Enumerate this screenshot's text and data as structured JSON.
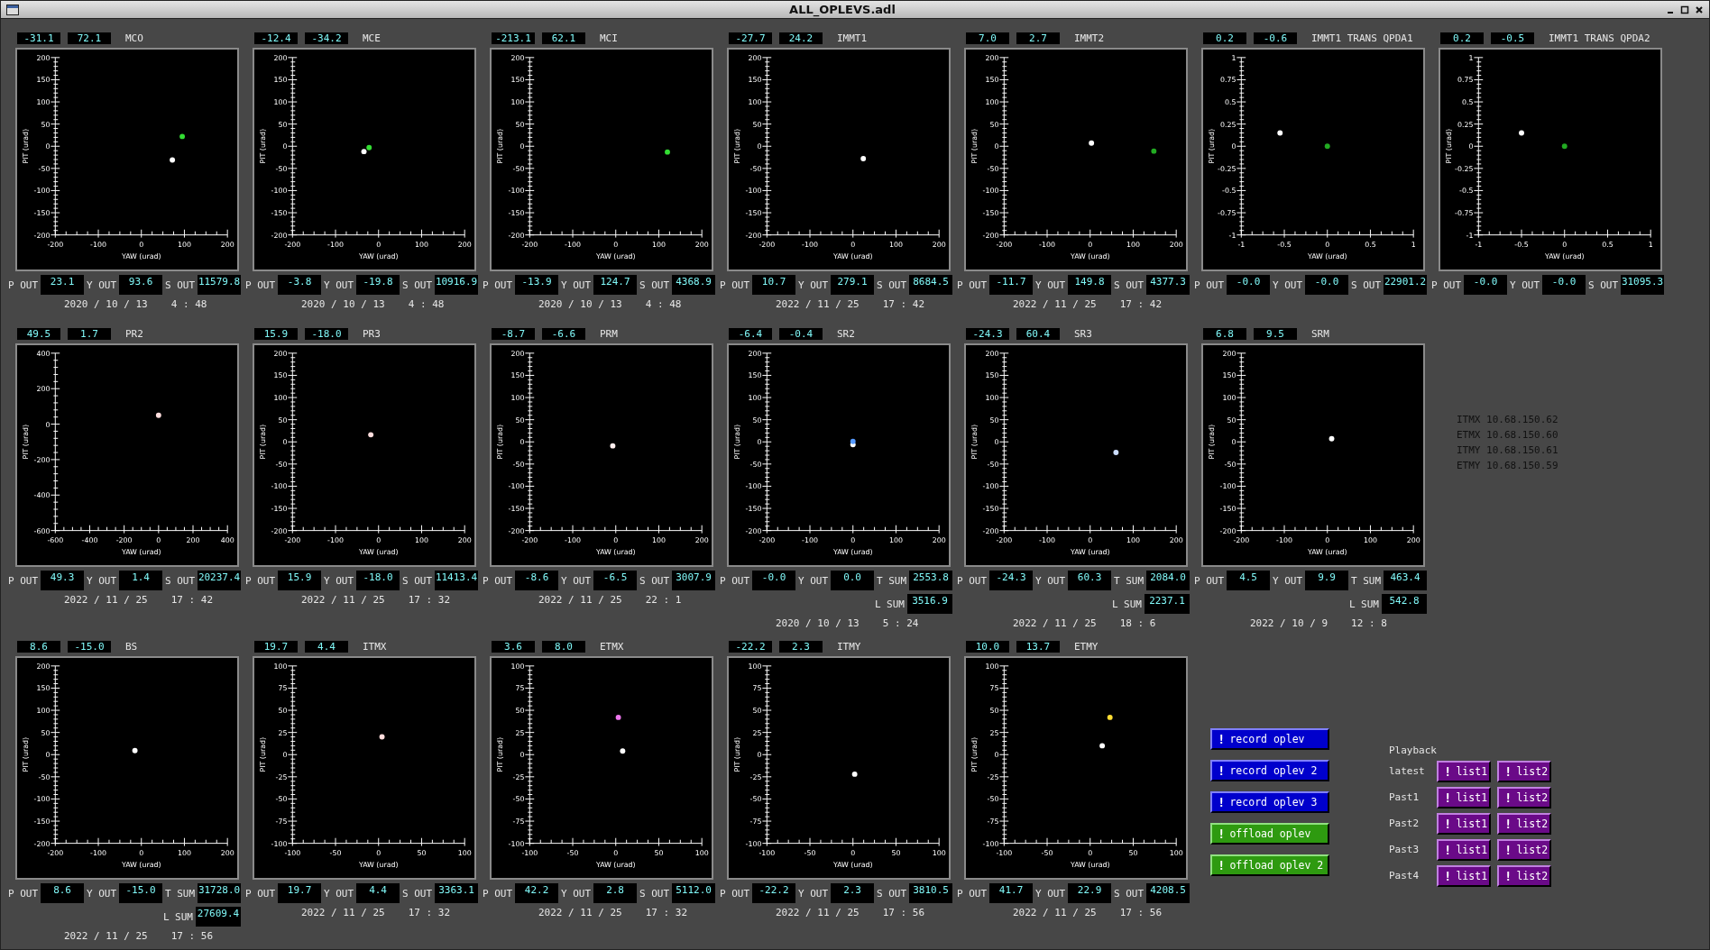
{
  "title_bar": {
    "title": "ALL_OPLEVS.adl"
  },
  "rows": [
    {
      "panels": [
        {
          "name": "MCO",
          "heading": [
            "-31.1",
            "72.1"
          ],
          "readouts": [
            {
              "label": "P OUT",
              "value": "23.1"
            },
            {
              "label": "Y OUT",
              "value": "93.6"
            },
            {
              "label": "S OUT",
              "value": "11579.8"
            }
          ],
          "date": "2020 / 10 / 13",
          "time": "4 : 48",
          "chart_data": {
            "type": "scatter",
            "xlabel": "YAW (urad)",
            "ylabel": "PIT (urad)",
            "xlim": [
              -200,
              200
            ],
            "ylim": [
              -200,
              200
            ],
            "xticks": [
              -200,
              -100,
              0,
              100,
              200
            ],
            "yticks": [
              -200,
              -150,
              -100,
              -50,
              0,
              50,
              100,
              150,
              200
            ],
            "series": [
              {
                "color": "#ffffff",
                "x": [
                  72
                ],
                "values": [
                  -31
                ]
              },
              {
                "color": "#33dd33",
                "x": [
                  95
                ],
                "values": [
                  22
                ]
              }
            ]
          }
        },
        {
          "name": "MCE",
          "heading": [
            "-12.4",
            "-34.2"
          ],
          "readouts": [
            {
              "label": "P OUT",
              "value": "-3.8"
            },
            {
              "label": "Y OUT",
              "value": "-19.8"
            },
            {
              "label": "S OUT",
              "value": "10916.9"
            }
          ],
          "date": "2020 / 10 / 13",
          "time": "4 : 48",
          "chart_data": {
            "type": "scatter",
            "xlabel": "YAW (urad)",
            "ylabel": "PIT (urad)",
            "xlim": [
              -200,
              200
            ],
            "ylim": [
              -200,
              200
            ],
            "xticks": [
              -200,
              -100,
              0,
              100,
              200
            ],
            "yticks": [
              -200,
              -150,
              -100,
              -50,
              0,
              50,
              100,
              150,
              200
            ],
            "series": [
              {
                "color": "#ffffff",
                "x": [
                  -34
                ],
                "values": [
                  -12
                ]
              },
              {
                "color": "#33dd33",
                "x": [
                  -22
                ],
                "values": [
                  -3
                ]
              }
            ]
          }
        },
        {
          "name": "MCI",
          "heading": [
            "-213.1",
            "62.1"
          ],
          "readouts": [
            {
              "label": "P OUT",
              "value": "-13.9"
            },
            {
              "label": "Y OUT",
              "value": "124.7"
            },
            {
              "label": "S OUT",
              "value": "4368.9"
            }
          ],
          "date": "2020 / 10 / 13",
          "time": "4 : 48",
          "chart_data": {
            "type": "scatter",
            "xlabel": "YAW (urad)",
            "ylabel": "PIT (urad)",
            "xlim": [
              -200,
              200
            ],
            "ylim": [
              -200,
              200
            ],
            "xticks": [
              -200,
              -100,
              0,
              100,
              200
            ],
            "yticks": [
              -200,
              -150,
              -100,
              -50,
              0,
              50,
              100,
              150,
              200
            ],
            "series": [
              {
                "color": "#33dd33",
                "x": [
                  120
                ],
                "values": [
                  -13
                ]
              }
            ]
          }
        },
        {
          "name": "IMMT1",
          "heading": [
            "-27.7",
            "24.2"
          ],
          "readouts": [
            {
              "label": "P OUT",
              "value": "10.7"
            },
            {
              "label": "Y OUT",
              "value": "279.1"
            },
            {
              "label": "S OUT",
              "value": "8684.5"
            }
          ],
          "date": "2022 / 11 / 25",
          "time": "17 : 42",
          "chart_data": {
            "type": "scatter",
            "xlabel": "YAW (urad)",
            "ylabel": "PIT (urad)",
            "xlim": [
              -200,
              200
            ],
            "ylim": [
              -200,
              200
            ],
            "xticks": [
              -200,
              -100,
              0,
              100,
              200
            ],
            "yticks": [
              -200,
              -150,
              -100,
              -50,
              0,
              50,
              100,
              150,
              200
            ],
            "series": [
              {
                "color": "#ffffff",
                "x": [
                  24
                ],
                "values": [
                  -28
                ]
              }
            ]
          }
        },
        {
          "name": "IMMT2",
          "heading": [
            "7.0",
            "2.7"
          ],
          "readouts": [
            {
              "label": "P OUT",
              "value": "-11.7"
            },
            {
              "label": "Y OUT",
              "value": "149.8"
            },
            {
              "label": "S OUT",
              "value": "4377.3"
            }
          ],
          "date": "2022 / 11 / 25",
          "time": "17 : 42",
          "chart_data": {
            "type": "scatter",
            "xlabel": "YAW (urad)",
            "ylabel": "PIT (urad)",
            "xlim": [
              -200,
              200
            ],
            "ylim": [
              -200,
              200
            ],
            "xticks": [
              -200,
              -100,
              0,
              100,
              200
            ],
            "yticks": [
              -200,
              -150,
              -100,
              -50,
              0,
              50,
              100,
              150,
              200
            ],
            "series": [
              {
                "color": "#ffffff",
                "x": [
                  3
                ],
                "values": [
                  7
                ]
              },
              {
                "color": "#22aa22",
                "x": [
                  148
                ],
                "values": [
                  -11
                ]
              }
            ]
          }
        },
        {
          "name": "IMMT1 TRANS QPDA1",
          "heading": [
            "0.2",
            "-0.6"
          ],
          "readouts": [
            {
              "label": "P OUT",
              "value": "-0.0"
            },
            {
              "label": "Y OUT",
              "value": "-0.0"
            },
            {
              "label": "S OUT",
              "value": "22901.2"
            }
          ],
          "chart_data": {
            "type": "scatter",
            "xlabel": "YAW (urad)",
            "ylabel": "PIT (urad)",
            "xlim": [
              -1,
              1
            ],
            "ylim": [
              -1,
              1
            ],
            "xticks": [
              -1,
              -0.5,
              0,
              0.5,
              1
            ],
            "yticks": [
              -1,
              -0.75,
              -0.5,
              -0.25,
              0,
              0.25,
              0.5,
              0.75,
              1
            ],
            "series": [
              {
                "color": "#ffffff",
                "x": [
                  -0.55
                ],
                "values": [
                  0.15
                ]
              },
              {
                "color": "#22aa22",
                "x": [
                  0
                ],
                "values": [
                  0
                ]
              }
            ]
          }
        },
        {
          "name": "IMMT1 TRANS QPDA2",
          "heading": [
            "0.2",
            "-0.5"
          ],
          "readouts": [
            {
              "label": "P OUT",
              "value": "-0.0"
            },
            {
              "label": "Y OUT",
              "value": "-0.0"
            },
            {
              "label": "S OUT",
              "value": "31095.3"
            }
          ],
          "chart_data": {
            "type": "scatter",
            "xlabel": "YAW (urad)",
            "ylabel": "PIT (urad)",
            "xlim": [
              -1,
              1
            ],
            "ylim": [
              -1,
              1
            ],
            "xticks": [
              -1,
              -0.5,
              0,
              0.5,
              1
            ],
            "yticks": [
              -1,
              -0.75,
              -0.5,
              -0.25,
              0,
              0.25,
              0.5,
              0.75,
              1
            ],
            "series": [
              {
                "color": "#ffffff",
                "x": [
                  -0.5
                ],
                "values": [
                  0.15
                ]
              },
              {
                "color": "#22aa22",
                "x": [
                  0
                ],
                "values": [
                  0
                ]
              }
            ]
          }
        }
      ]
    },
    {
      "panels": [
        {
          "name": "PR2",
          "heading": [
            "49.5",
            "1.7"
          ],
          "readouts": [
            {
              "label": "P OUT",
              "value": "49.3"
            },
            {
              "label": "Y OUT",
              "value": "1.4"
            },
            {
              "label": "S OUT",
              "value": "20237.4"
            }
          ],
          "date": "2022 / 11 / 25",
          "time": "17 : 42",
          "chart_data": {
            "type": "scatter",
            "xlabel": "YAW (urad)",
            "ylabel": "PIT (urad)",
            "xlim": [
              -600,
              400
            ],
            "ylim": [
              -600,
              400
            ],
            "xticks": [
              -600,
              -400,
              -200,
              0,
              200,
              400
            ],
            "yticks": [
              -600,
              -400,
              -200,
              0,
              200,
              400
            ],
            "series": [
              {
                "color": "#ffdddd",
                "x": [
                  0
                ],
                "values": [
                  50
                ]
              }
            ]
          }
        },
        {
          "name": "PR3",
          "heading": [
            "15.9",
            "-18.0"
          ],
          "readouts": [
            {
              "label": "P OUT",
              "value": "15.9"
            },
            {
              "label": "Y OUT",
              "value": "-18.0"
            },
            {
              "label": "S OUT",
              "value": "11413.4"
            }
          ],
          "date": "2022 / 11 / 25",
          "time": "17 : 32",
          "chart_data": {
            "type": "scatter",
            "xlabel": "YAW (urad)",
            "ylabel": "PIT (urad)",
            "xlim": [
              -200,
              200
            ],
            "ylim": [
              -200,
              200
            ],
            "xticks": [
              -200,
              -100,
              0,
              100,
              200
            ],
            "yticks": [
              -200,
              -150,
              -100,
              -50,
              0,
              50,
              100,
              150,
              200
            ],
            "series": [
              {
                "color": "#ffdddd",
                "x": [
                  -18
                ],
                "values": [
                  16
                ]
              }
            ]
          }
        },
        {
          "name": "PRM",
          "heading": [
            "-8.7",
            "-6.6"
          ],
          "readouts": [
            {
              "label": "P OUT",
              "value": "-8.6"
            },
            {
              "label": "Y OUT",
              "value": "-6.5"
            },
            {
              "label": "S OUT",
              "value": "3007.9"
            }
          ],
          "date": "2022 / 11 / 25",
          "time": "22 : 1",
          "chart_data": {
            "type": "scatter",
            "xlabel": "YAW (urad)",
            "ylabel": "PIT (urad)",
            "xlim": [
              -200,
              200
            ],
            "ylim": [
              -200,
              200
            ],
            "xticks": [
              -200,
              -100,
              0,
              100,
              200
            ],
            "yticks": [
              -200,
              -150,
              -100,
              -50,
              0,
              50,
              100,
              150,
              200
            ],
            "series": [
              {
                "color": "#ffeeee",
                "x": [
                  -7
                ],
                "values": [
                  -9
                ]
              }
            ]
          }
        },
        {
          "name": "SR2",
          "heading": [
            "-6.4",
            "-0.4"
          ],
          "readouts": [
            {
              "label": "P OUT",
              "value": "-0.0"
            },
            {
              "label": "Y OUT",
              "value": "0.0"
            },
            {
              "label": "T SUM",
              "value": "2553.8"
            }
          ],
          "extra_readout": {
            "label": "L SUM",
            "value": "3516.9"
          },
          "date": "2020 / 10 / 13",
          "time": "5 : 24",
          "chart_data": {
            "type": "scatter",
            "xlabel": "YAW (urad)",
            "ylabel": "PIT (urad)",
            "xlim": [
              -200,
              200
            ],
            "ylim": [
              -200,
              200
            ],
            "xticks": [
              -200,
              -100,
              0,
              100,
              200
            ],
            "yticks": [
              -200,
              -150,
              -100,
              -50,
              0,
              50,
              100,
              150,
              200
            ],
            "series": [
              {
                "color": "#ffffff",
                "x": [
                  0
                ],
                "values": [
                  -6
                ]
              },
              {
                "color": "#5599ff",
                "x": [
                  0
                ],
                "values": [
                  1
                ]
              }
            ]
          }
        },
        {
          "name": "SR3",
          "heading": [
            "-24.3",
            "60.4"
          ],
          "readouts": [
            {
              "label": "P OUT",
              "value": "-24.3"
            },
            {
              "label": "Y OUT",
              "value": "60.3"
            },
            {
              "label": "T SUM",
              "value": "2084.0"
            }
          ],
          "extra_readout": {
            "label": "L SUM",
            "value": "2237.1"
          },
          "date": "2022 / 11 / 25",
          "time": "18 : 6",
          "chart_data": {
            "type": "scatter",
            "xlabel": "YAW (urad)",
            "ylabel": "PIT (urad)",
            "xlim": [
              -200,
              200
            ],
            "ylim": [
              -200,
              200
            ],
            "xticks": [
              -200,
              -100,
              0,
              100,
              200
            ],
            "yticks": [
              -200,
              -150,
              -100,
              -50,
              0,
              50,
              100,
              150,
              200
            ],
            "series": [
              {
                "color": "#ccddff",
                "x": [
                  60
                ],
                "values": [
                  -24
                ]
              }
            ]
          }
        },
        {
          "name": "SRM",
          "heading": [
            "6.8",
            "9.5"
          ],
          "readouts": [
            {
              "label": "P OUT",
              "value": "4.5"
            },
            {
              "label": "Y OUT",
              "value": "9.9"
            },
            {
              "label": "T SUM",
              "value": "463.4"
            }
          ],
          "extra_readout": {
            "label": "L SUM",
            "value": "542.8"
          },
          "date": "2022 / 10 / 9",
          "time": "12 : 8",
          "chart_data": {
            "type": "scatter",
            "xlabel": "YAW (urad)",
            "ylabel": "PIT (urad)",
            "xlim": [
              -200,
              200
            ],
            "ylim": [
              -200,
              200
            ],
            "xticks": [
              -200,
              -100,
              0,
              100,
              200
            ],
            "yticks": [
              -200,
              -150,
              -100,
              -50,
              0,
              50,
              100,
              150,
              200
            ],
            "series": [
              {
                "color": "#ffffff",
                "x": [
                  10
                ],
                "values": [
                  7
                ]
              }
            ]
          }
        }
      ]
    },
    {
      "panels": [
        {
          "name": "BS",
          "heading": [
            "8.6",
            "-15.0"
          ],
          "readouts": [
            {
              "label": "P OUT",
              "value": "8.6"
            },
            {
              "label": "Y OUT",
              "value": "-15.0"
            },
            {
              "label": "T SUM",
              "value": "31728.0"
            }
          ],
          "extra_readout": {
            "label": "L SUM",
            "value": "27609.4"
          },
          "date": "2022 / 11 / 25",
          "time": "17 : 56",
          "chart_data": {
            "type": "scatter",
            "xlabel": "YAW (urad)",
            "ylabel": "PIT (urad)",
            "xlim": [
              -200,
              200
            ],
            "ylim": [
              -200,
              200
            ],
            "xticks": [
              -200,
              -100,
              0,
              100,
              200
            ],
            "yticks": [
              -200,
              -150,
              -100,
              -50,
              0,
              50,
              100,
              150,
              200
            ],
            "series": [
              {
                "color": "#ffffff",
                "x": [
                  -15
                ],
                "values": [
                  9
                ]
              }
            ]
          }
        },
        {
          "name": "ITMX",
          "heading": [
            "19.7",
            "4.4"
          ],
          "readouts": [
            {
              "label": "P OUT",
              "value": "19.7"
            },
            {
              "label": "Y OUT",
              "value": "4.4"
            },
            {
              "label": "S OUT",
              "value": "3363.1"
            }
          ],
          "date": "2022 / 11 / 25",
          "time": "17 : 32",
          "chart_data": {
            "type": "scatter",
            "xlabel": "YAW (urad)",
            "ylabel": "PIT (urad)",
            "xlim": [
              -100,
              100
            ],
            "ylim": [
              -100,
              100
            ],
            "xticks": [
              -100,
              -50,
              0,
              50,
              100
            ],
            "yticks": [
              -100,
              -75,
              -50,
              -25,
              0,
              25,
              50,
              75,
              100
            ],
            "series": [
              {
                "color": "#ffdddd",
                "x": [
                  4
                ],
                "values": [
                  20
                ]
              }
            ]
          }
        },
        {
          "name": "ETMX",
          "heading": [
            "3.6",
            "8.0"
          ],
          "readouts": [
            {
              "label": "P OUT",
              "value": "42.2"
            },
            {
              "label": "Y OUT",
              "value": "2.8"
            },
            {
              "label": "S OUT",
              "value": "5112.0"
            }
          ],
          "date": "2022 / 11 / 25",
          "time": "17 : 32",
          "chart_data": {
            "type": "scatter",
            "xlabel": "YAW (urad)",
            "ylabel": "PIT (urad)",
            "xlim": [
              -100,
              100
            ],
            "ylim": [
              -100,
              100
            ],
            "xticks": [
              -100,
              -50,
              0,
              50,
              100
            ],
            "yticks": [
              -100,
              -75,
              -50,
              -25,
              0,
              25,
              50,
              75,
              100
            ],
            "series": [
              {
                "color": "#ffffff",
                "x": [
                  8
                ],
                "values": [
                  4
                ]
              },
              {
                "color": "#ee77ee",
                "x": [
                  3
                ],
                "values": [
                  42
                ]
              }
            ]
          }
        },
        {
          "name": "ITMY",
          "heading": [
            "-22.2",
            "2.3"
          ],
          "readouts": [
            {
              "label": "P OUT",
              "value": "-22.2"
            },
            {
              "label": "Y OUT",
              "value": "2.3"
            },
            {
              "label": "S OUT",
              "value": "3810.5"
            }
          ],
          "date": "2022 / 11 / 25",
          "time": "17 : 56",
          "chart_data": {
            "type": "scatter",
            "xlabel": "YAW (urad)",
            "ylabel": "PIT (urad)",
            "xlim": [
              -100,
              100
            ],
            "ylim": [
              -100,
              100
            ],
            "xticks": [
              -100,
              -50,
              0,
              50,
              100
            ],
            "yticks": [
              -100,
              -75,
              -50,
              -25,
              0,
              25,
              50,
              75,
              100
            ],
            "series": [
              {
                "color": "#ffffff",
                "x": [
                  2
                ],
                "values": [
                  -22
                ]
              }
            ]
          }
        },
        {
          "name": "ETMY",
          "heading": [
            "10.0",
            "13.7"
          ],
          "readouts": [
            {
              "label": "P OUT",
              "value": "41.7"
            },
            {
              "label": "Y OUT",
              "value": "22.9"
            },
            {
              "label": "S OUT",
              "value": "4208.5"
            }
          ],
          "date": "2022 / 11 / 25",
          "time": "17 : 56",
          "chart_data": {
            "type": "scatter",
            "xlabel": "YAW (urad)",
            "ylabel": "PIT (urad)",
            "xlim": [
              -100,
              100
            ],
            "ylim": [
              -100,
              100
            ],
            "xticks": [
              -100,
              -50,
              0,
              50,
              100
            ],
            "yticks": [
              -100,
              -75,
              -50,
              -25,
              0,
              25,
              50,
              75,
              100
            ],
            "series": [
              {
                "color": "#ffffff",
                "x": [
                  14
                ],
                "values": [
                  10
                ]
              },
              {
                "color": "#ffdd33",
                "x": [
                  23
                ],
                "values": [
                  42
                ]
              }
            ]
          }
        }
      ]
    }
  ],
  "address_list": [
    "ITMX 10.68.150.62",
    "ETMX 10.68.150.60",
    "ITMY 10.68.150.61",
    "ETMY 10.68.150.59"
  ],
  "oplev_buttons": [
    {
      "kind": "record",
      "glyph": "!",
      "label": "record oplev"
    },
    {
      "kind": "record",
      "glyph": "!",
      "label": "record oplev 2"
    },
    {
      "kind": "record",
      "glyph": "!",
      "label": "record oplev 3"
    },
    {
      "kind": "offload",
      "glyph": "!",
      "label": "offload oplev"
    },
    {
      "kind": "offload",
      "glyph": "!",
      "label": "offload oplev 2"
    }
  ],
  "playback": {
    "title": "Playback",
    "rows": [
      {
        "label": "latest",
        "buttons": [
          {
            "glyph": "!",
            "label": "list1"
          },
          {
            "glyph": "!",
            "label": "list2"
          }
        ]
      },
      {
        "label": "Past1",
        "buttons": [
          {
            "glyph": "!",
            "label": "list1"
          },
          {
            "glyph": "!",
            "label": "list2"
          }
        ]
      },
      {
        "label": "Past2",
        "buttons": [
          {
            "glyph": "!",
            "label": "list1"
          },
          {
            "glyph": "!",
            "label": "list2"
          }
        ]
      },
      {
        "label": "Past3",
        "buttons": [
          {
            "glyph": "!",
            "label": "list1"
          },
          {
            "glyph": "!",
            "label": "list2"
          }
        ]
      },
      {
        "label": "Past4",
        "buttons": [
          {
            "glyph": "!",
            "label": "list1"
          },
          {
            "glyph": "!",
            "label": "list2"
          }
        ]
      }
    ]
  }
}
